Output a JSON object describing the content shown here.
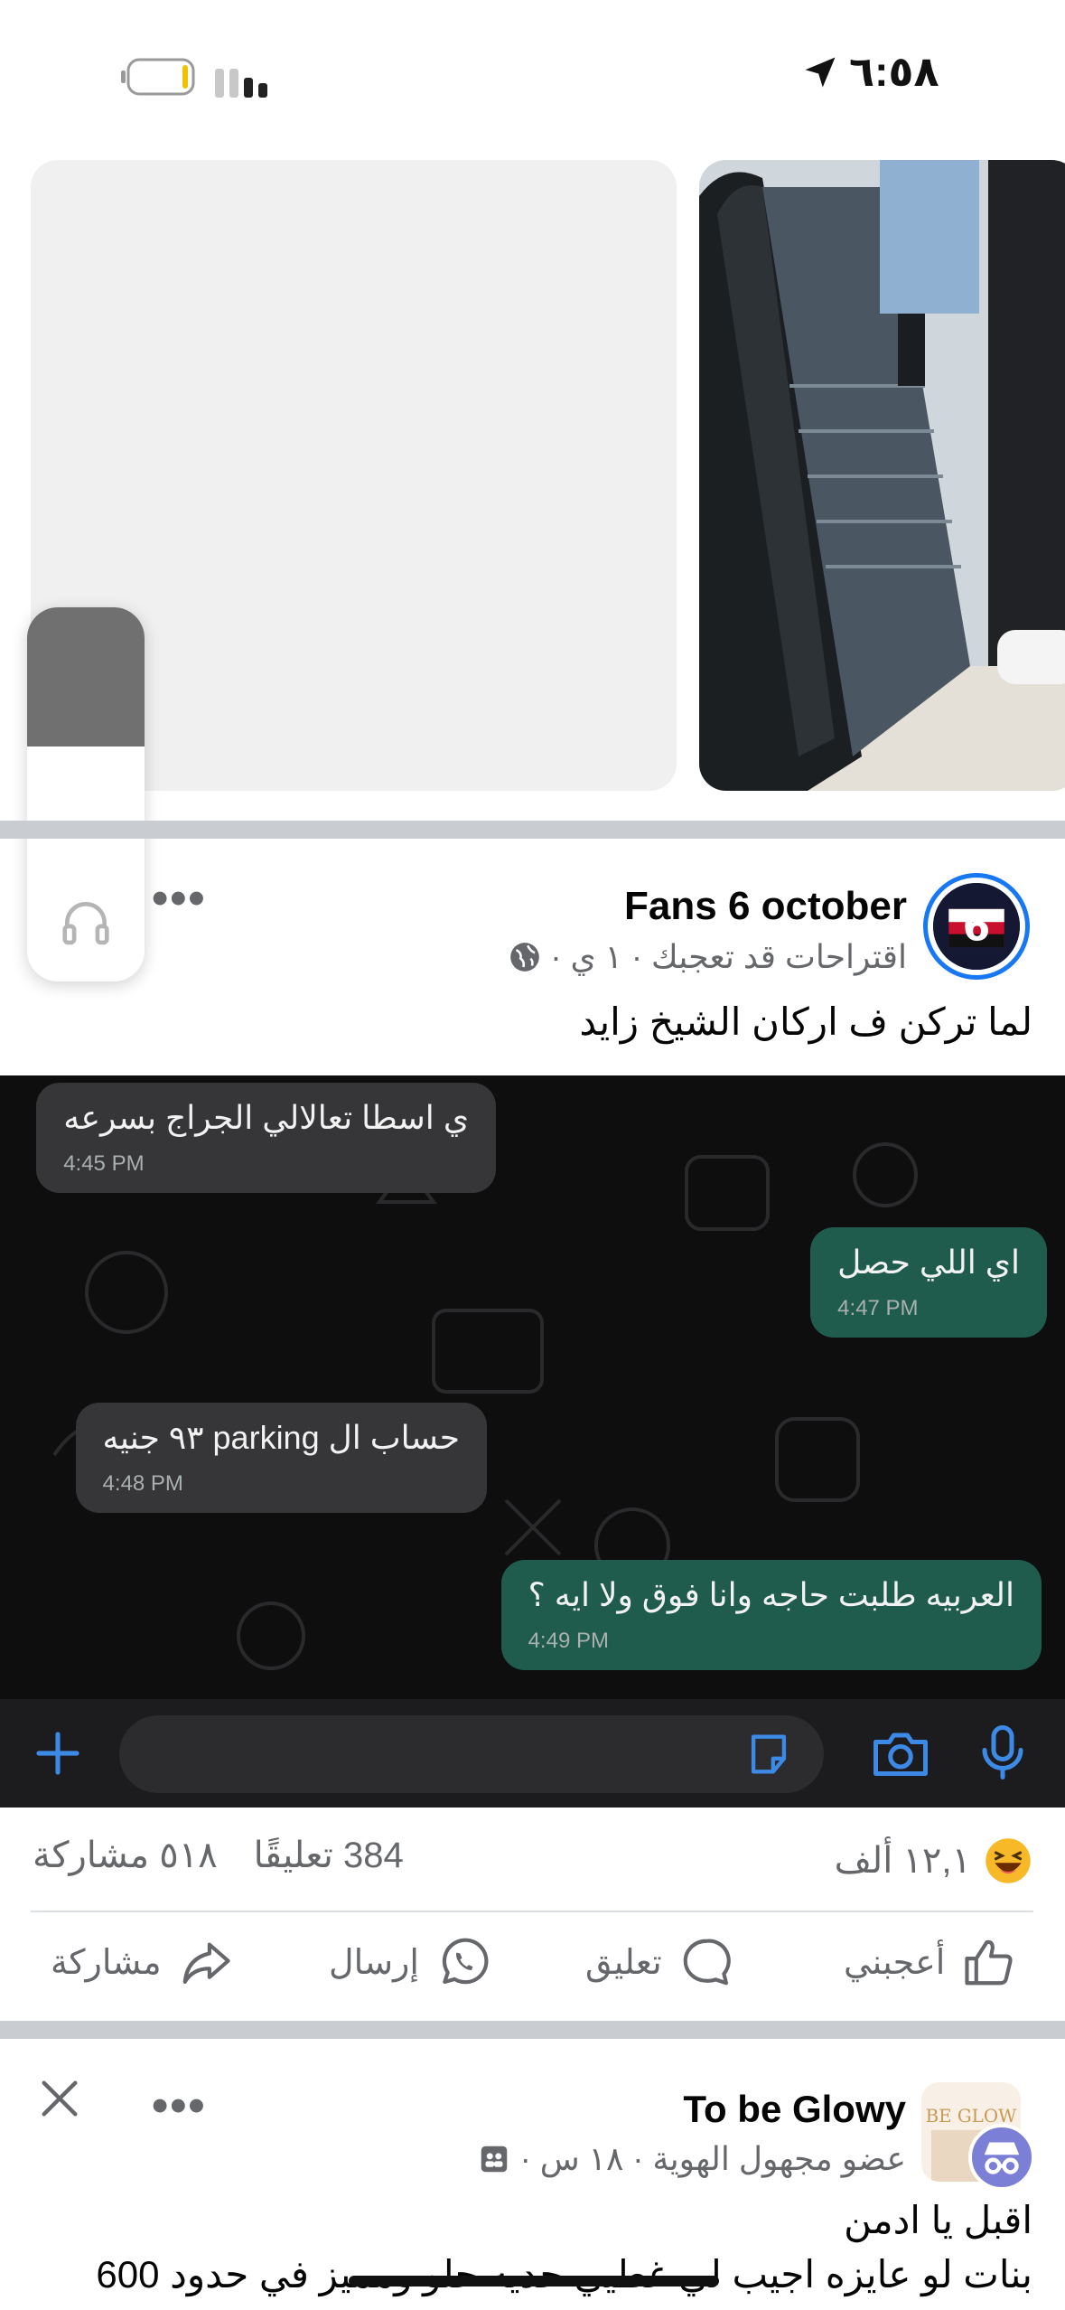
{
  "status_bar": {
    "time": "٦:٥٨",
    "icons": [
      "location-arrow-icon",
      "signal-icon",
      "battery-icon"
    ]
  },
  "volume_hud": {
    "level": 0.37,
    "icon": "headphones-icon"
  },
  "post1": {
    "page_name": "Fans 6 october",
    "meta": "اقتراحات قد تعجبك · ١ ي ·",
    "privacy_icon": "globe-icon",
    "caption": "لما تركن ف اركان الشيخ زايد",
    "more_label": "•••",
    "chat_image": {
      "messages": [
        {
          "side": "in",
          "text": "ي اسطا تعالالي الجراج بسرعه",
          "time": "4:45 PM"
        },
        {
          "side": "out",
          "text": "اي اللي حصل",
          "time": "4:47 PM"
        },
        {
          "side": "in",
          "text": "حساب ال parking ٩٣ جنيه",
          "time": "4:48 PM"
        },
        {
          "side": "out",
          "text": "العربيه طلبت حاجه وانا فوق ولا ايه ؟",
          "time": "4:49 PM"
        }
      ]
    },
    "reactions": {
      "count": "١٢,١ ألف",
      "icon": "laughing-emoji-icon"
    },
    "comments": "384 تعليقًا",
    "shares": "٥١٨ مشاركة",
    "actions": {
      "like": "أعجبني",
      "comment": "تعليق",
      "send": "إرسال",
      "share": "مشاركة"
    }
  },
  "post2": {
    "group_name": "To be Glowy",
    "meta": "عضو مجهول الهوية · ١٨ س ·",
    "line1": "اقبل يا ادمن",
    "line2": "بنات لو عايزه اجيب لي غطيي حديه حلو ومميز في حدود 600",
    "more_label": "•••",
    "close_label": "✕"
  },
  "colors": {
    "facebook_blue": "#1877f2",
    "secondary_text": "#65676b",
    "chat_outgoing": "#1f5c4d",
    "chat_incoming": "#363638"
  }
}
